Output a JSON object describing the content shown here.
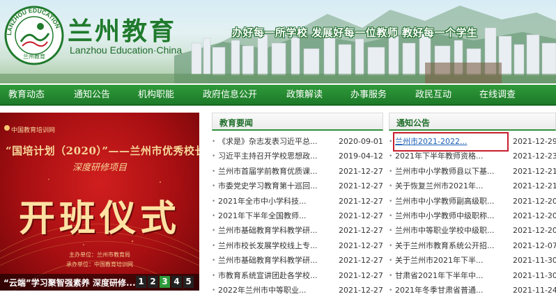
{
  "header": {
    "logo_ring_text": "LANZHOU EDUCATION",
    "logo_inner_text": "兰州教育",
    "brand_cn": "兰州教育",
    "brand_en": "Lanzhou Education·China",
    "slogan": "办好每一所学校 发展好每一位教师 教好每一个学生"
  },
  "nav": {
    "items": [
      {
        "label": "教育动态"
      },
      {
        "label": "通知公告"
      },
      {
        "label": "机构职能"
      },
      {
        "label": "政府信息公开"
      },
      {
        "label": "政策解读"
      },
      {
        "label": "办事服务"
      },
      {
        "label": "政民互动"
      },
      {
        "label": "在线调查"
      }
    ]
  },
  "slideshow": {
    "logo_text": "中国教育培训网",
    "heading": "“国培计划（2020）”——兰州市优秀校长",
    "subheading": "深度研修项目",
    "big_text": "开班仪式",
    "org_host": "主办单位：兰州市教育局",
    "org_organizer": "承办单位：中国教育培训网",
    "caption": "“云端”学习聚智强素养 深度研修...",
    "pages": [
      "1",
      "2",
      "3",
      "4",
      "5"
    ],
    "active_page": "3"
  },
  "news": {
    "title": "教育要闻",
    "items": [
      {
        "title": "《求是》杂志发表习近平总...",
        "date": "2020-09-01"
      },
      {
        "title": "习近平主持召开学校思想政...",
        "date": "2019-04-12"
      },
      {
        "title": "兰州市首届学前教育优质课...",
        "date": "2021-12-27"
      },
      {
        "title": "市委党史学习教育第十巡回...",
        "date": "2021-12-27"
      },
      {
        "title": "2021年全市中小学科技...",
        "date": "2021-12-27"
      },
      {
        "title": "2021年下半年全国教师...",
        "date": "2021-12-27"
      },
      {
        "title": "兰州市基础教育学科教学研...",
        "date": "2021-12-27"
      },
      {
        "title": "兰州市校长发展学校线上专...",
        "date": "2021-12-27"
      },
      {
        "title": "兰州市基础教育学科教学研...",
        "date": "2021-12-27"
      },
      {
        "title": "市教育系统宣讲团赴各学校...",
        "date": "2021-12-27"
      },
      {
        "title": "2022年兰州市中等职业...",
        "date": "2021-12-27"
      }
    ]
  },
  "notices": {
    "title": "通知公告",
    "items": [
      {
        "title": "兰州市2021-2022...",
        "date": "2021-12-29"
      },
      {
        "title": "2021年下半年教师资格...",
        "date": "2021-12-23"
      },
      {
        "title": "兰州市中小学教师县以下基...",
        "date": "2021-12-21"
      },
      {
        "title": "关于恢复兰州市2021年...",
        "date": "2021-12-21"
      },
      {
        "title": "兰州市中小学教师副高级职...",
        "date": "2021-12-20"
      },
      {
        "title": "兰州市中小学教师中级职称...",
        "date": "2021-12-20"
      },
      {
        "title": "兰州市中等职业学校中级职...",
        "date": "2021-12-20"
      },
      {
        "title": "关于兰州市教育系统公开招...",
        "date": "2021-12-07"
      },
      {
        "title": "关于兰州市2021年下半...",
        "date": "2021-11-30"
      },
      {
        "title": "甘肃省2021年下半年中...",
        "date": "2021-11-30"
      },
      {
        "title": "2021年冬季甘肃省普通...",
        "date": "2021-11-24"
      }
    ]
  },
  "colors": {
    "brand_green": "#1f7a2c",
    "nav_green": "#2a8f36",
    "slide_red": "#b5121b",
    "highlight_outline": "#c81d2c",
    "link_blue": "#1a5fb4"
  }
}
